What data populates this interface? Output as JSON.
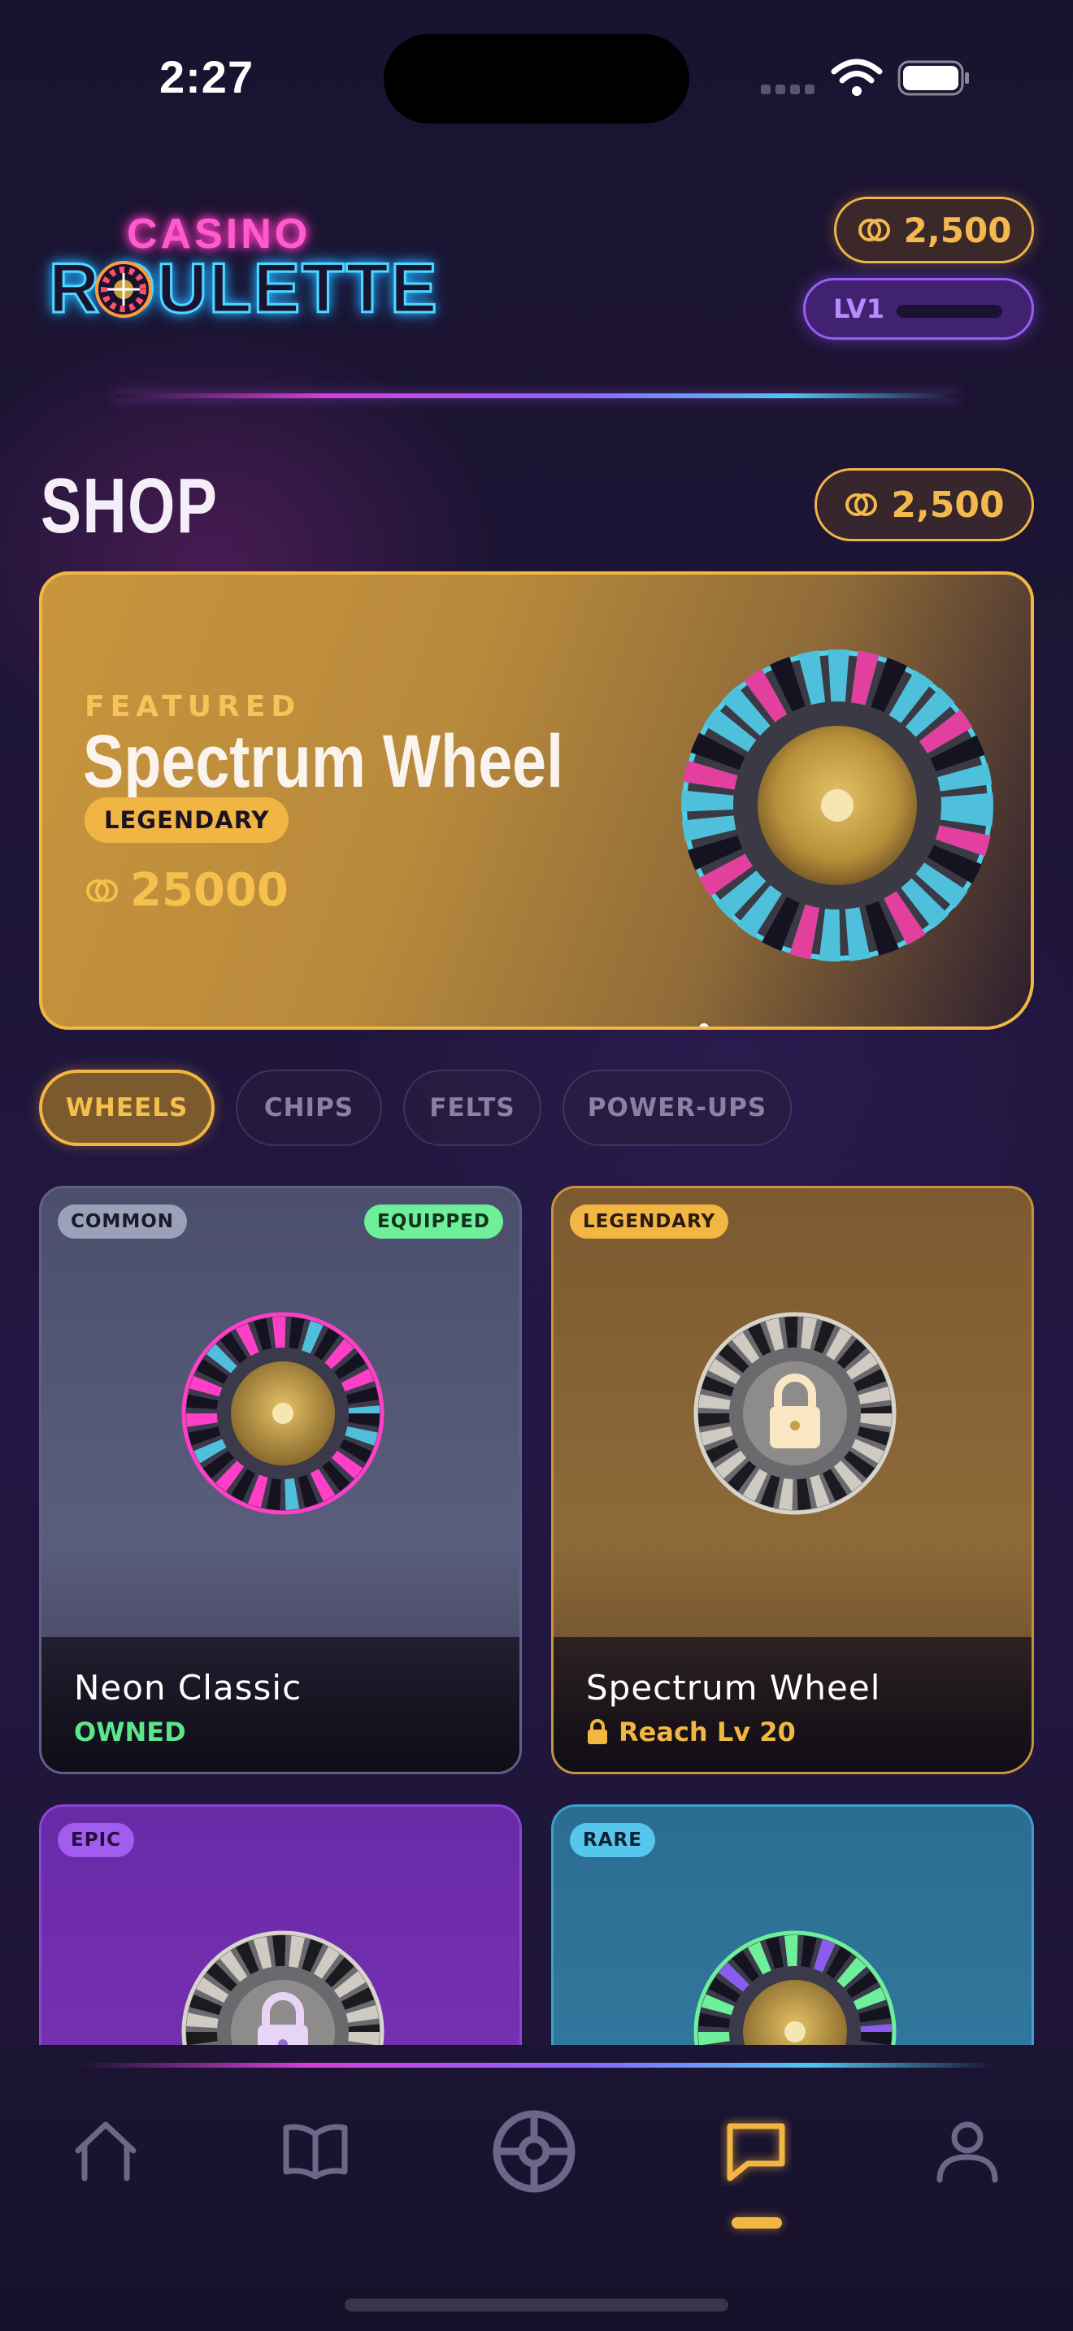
{
  "status_bar": {
    "time": "2:27"
  },
  "header": {
    "logo_top": "CASINO",
    "logo_main": "ROULETTE",
    "coins": "2,500",
    "level": "LV1"
  },
  "shop": {
    "title": "SHOP",
    "coins": "2,500"
  },
  "featured": {
    "label": "FEATURED",
    "name": "Spectrum Wheel",
    "rarity": "LEGENDARY",
    "price": "25000"
  },
  "tabs": [
    {
      "label": "WHEELS",
      "active": true
    },
    {
      "label": "CHIPS",
      "active": false
    },
    {
      "label": "FELTS",
      "active": false
    },
    {
      "label": "POWER-UPS",
      "active": false
    }
  ],
  "items": [
    {
      "rarity": "COMMON",
      "badge": "EQUIPPED",
      "name": "Neon Classic",
      "status": "OWNED",
      "locked": false
    },
    {
      "rarity": "LEGENDARY",
      "name": "Spectrum Wheel",
      "status": "Reach Lv 20",
      "locked": true
    },
    {
      "rarity": "EPIC",
      "locked": true
    },
    {
      "rarity": "RARE",
      "locked": false
    }
  ],
  "nav": {
    "items": [
      "home-icon",
      "book-icon",
      "wheel-icon",
      "shop-icon",
      "profile-icon"
    ],
    "active": "shop-icon"
  },
  "colors": {
    "accent_gold": "#f2b642",
    "accent_purple": "#9b5cf6",
    "owned_green": "#5de58a",
    "background": "#1b1430"
  }
}
